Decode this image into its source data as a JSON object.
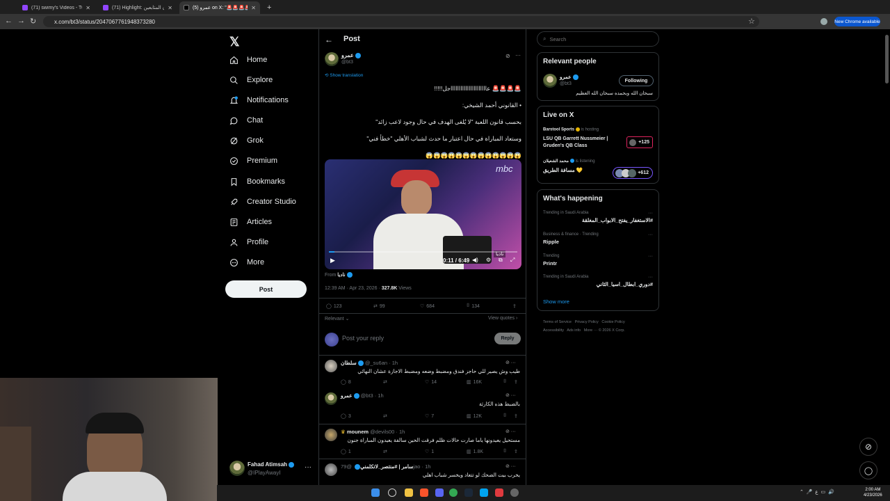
{
  "tabs": [
    {
      "title": "(71) swimy's Videos - Twitch"
    },
    {
      "title": "(71) Highlight: رايكون المتابعين"
    },
    {
      "title": "عمرو (5) on X: \"🚨🚨🚨🚨 عا..."
    }
  ],
  "url": "x.com/bt3/status/2047067761948373280",
  "new_chrome": "New Chrome available",
  "nav": [
    "Home",
    "Explore",
    "Notifications",
    "Chat",
    "Grok",
    "Premium",
    "Bookmarks",
    "Creator Studio",
    "Articles",
    "Profile",
    "More"
  ],
  "notif_badge": "",
  "post_button": "Post",
  "account": {
    "name": "Fahad Atimsah",
    "handle": "@IPlayAwayI"
  },
  "header": {
    "title": "Post"
  },
  "post": {
    "author": "عمرو",
    "handle": "@bt3",
    "show_translation": "Show translation",
    "lines": [
      "🚨🚨🚨🚨 عااااااااااااااااااااااجل!!!!!",
      "• القانوني أحمد الشيخي:",
      "بحسب قانون اللعبة \"لا يُلغى الهدف في حال وجود لاعب زائد\"",
      "وستعاد المباراة في حال اعتبار ما حدث لشباب الأهلي \"خطأ فني\"",
      "😱😱😱😱😱😱😱😱😱😱😱😱😱"
    ],
    "video_time": "0:11 / 6:49",
    "video_logo": "mbc",
    "video_tag": "ناديا",
    "from_label": "From",
    "from_name": "ناديا",
    "meta_time": "12:39 AM · Apr 23, 2026 · ",
    "views_count": "327.8K",
    "views_label": " Views",
    "replies": "123",
    "reposts": "99",
    "likes": "684",
    "bookmarks": "134",
    "sort_label": "Relevant",
    "view_quotes": "View quotes",
    "reply_placeholder": "Post your reply",
    "reply_button": "Reply"
  },
  "replies": [
    {
      "name": "سلطان",
      "handle": "@_su6an · 1h",
      "text": "طيب وش يصير للي حاجز فندق ومضبط وضعه ومضبط الاجازة عشان النهائي",
      "r": "8",
      "rt": "",
      "l": "14",
      "v": "16K"
    },
    {
      "name": "عمرو",
      "handle": "@bt3 · 1h",
      "text": "بالضبط هذه الكارثة",
      "r": "3",
      "rt": "",
      "l": "7",
      "v": "12K"
    },
    {
      "name": "mounem",
      "handle": "@devils00 · 1h",
      "text": "مستحيل يعيدونها ياما صارت حالات ظلم فرقت الحين سالفة يعيدون المباراة جنون",
      "r": "1",
      "rt": "",
      "l": "1",
      "v": "1.8K"
    },
    {
      "name": "سامر | #منتصر_لاتكلمني",
      "handle": "@79jao · 1h",
      "text": "يخرب بيت الضحك لو تتعاد ويخسر شباب اهلي",
      "r": "",
      "rt": "",
      "l": "",
      "v": ""
    }
  ],
  "search": {
    "placeholder": "Search"
  },
  "relevant": {
    "title": "Relevant people",
    "name": "عمرو",
    "handle": "@bt3",
    "bio": "سبحان الله وبحمده سبحان الله العظيم",
    "button": "Following"
  },
  "live": {
    "title": "Live on X",
    "items": [
      {
        "host": "Barstool Sports",
        "status": "is hosting",
        "title": "LSU QB Garrett Nussmeier | Gruden's QB Class",
        "count": "+125"
      },
      {
        "host": "محمد الشعيلان",
        "status": "is listening",
        "title": "مسافة الطريق 💛",
        "count": "+612"
      }
    ]
  },
  "happening": {
    "title": "What's happening",
    "items": [
      {
        "context": "Trending in Saudi Arabia",
        "topic": "#الاستغفار_يفتح_الابواب_المغلقة"
      },
      {
        "context": "Business & finance · Trending",
        "topic": "Ripple"
      },
      {
        "context": "Trending",
        "topic": "Printr"
      },
      {
        "context": "Trending in Saudi Arabia",
        "topic": "#دوري_ابطال_اسيا_الثاني"
      }
    ],
    "show_more": "Show more"
  },
  "footer": [
    "Terms of Service",
    "Privacy Policy",
    "Cookie Policy",
    "Accessibility",
    "Ads info",
    "More ···",
    "© 2026 X Corp."
  ],
  "clock": {
    "time": "2:00 AM",
    "date": "4/23/2026"
  },
  "colors": {
    "accent": "#1d9bf0",
    "live_border": "#e0245e",
    "bg": "#000000"
  }
}
